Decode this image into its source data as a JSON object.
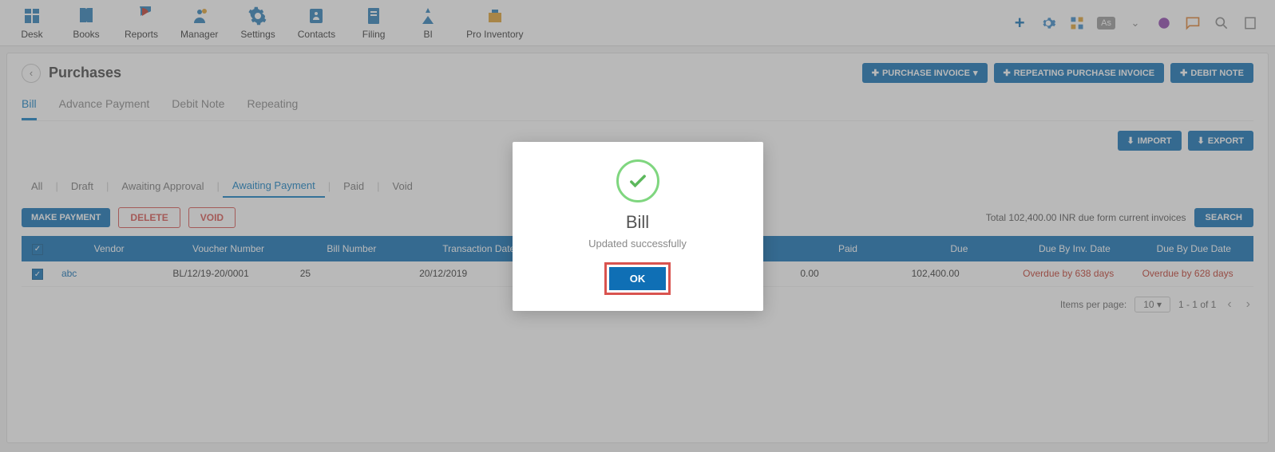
{
  "nav": [
    {
      "label": "Desk"
    },
    {
      "label": "Books"
    },
    {
      "label": "Reports"
    },
    {
      "label": "Manager"
    },
    {
      "label": "Settings"
    },
    {
      "label": "Contacts"
    },
    {
      "label": "Filing"
    },
    {
      "label": "BI"
    },
    {
      "label": "Pro Inventory"
    }
  ],
  "user_initials": "As",
  "page_title": "Purchases",
  "header_buttons": {
    "purchase_invoice": "PURCHASE INVOICE",
    "repeating": "REPEATING PURCHASE INVOICE",
    "debit_note": "DEBIT NOTE"
  },
  "main_tabs": [
    "Bill",
    "Advance Payment",
    "Debit Note",
    "Repeating"
  ],
  "main_tab_active": "Bill",
  "ie_buttons": {
    "import": "IMPORT",
    "export": "EXPORT"
  },
  "filter_tabs": [
    "All",
    "Draft",
    "Awaiting Approval",
    "Awaiting Payment",
    "Paid",
    "Void"
  ],
  "filter_tab_active": "Awaiting Payment",
  "actions": {
    "make_payment": "MAKE PAYMENT",
    "delete": "DELETE",
    "void": "VOID"
  },
  "total_due_text": "Total 102,400.00 INR due form current invoices",
  "search_label": "SEARCH",
  "table": {
    "headers": [
      "",
      "Vendor",
      "Voucher Number",
      "Bill Number",
      "Transaction Date",
      "",
      "Paid",
      "Due",
      "Due By Inv. Date",
      "Due By Due Date"
    ],
    "row": {
      "vendor": "abc",
      "voucher": "BL/12/19-20/0001",
      "bill_no": "25",
      "txn_date": "20/12/2019",
      "paid": "0.00",
      "due": "102,400.00",
      "due_inv": "Overdue by 638 days",
      "due_date": "Overdue by 628 days"
    }
  },
  "pagination": {
    "label": "Items per page:",
    "size": "10",
    "range": "1 - 1 of 1"
  },
  "modal": {
    "title": "Bill",
    "subtitle": "Updated successfully",
    "ok": "OK"
  }
}
